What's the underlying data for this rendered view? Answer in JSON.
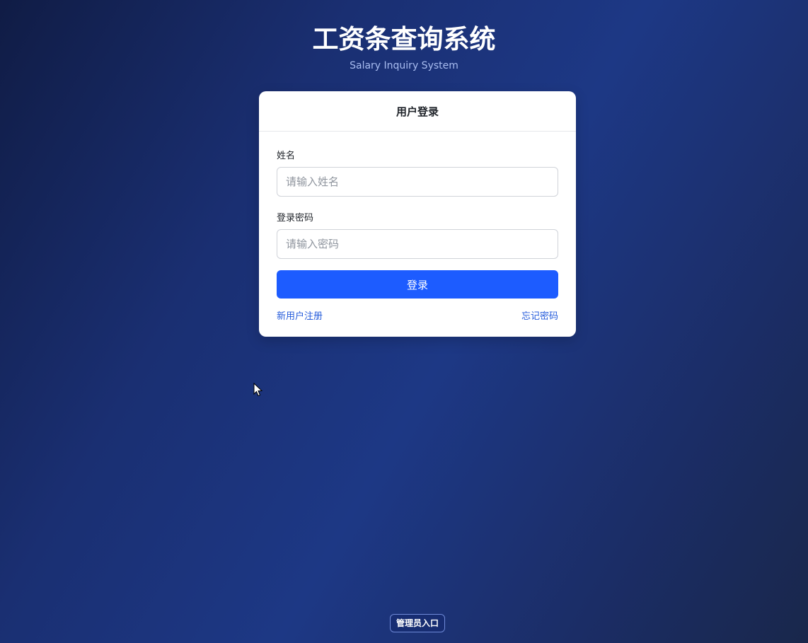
{
  "header": {
    "title": "工资条查询系统",
    "subtitle": "Salary Inquiry System"
  },
  "login_card": {
    "title": "用户登录",
    "name_field": {
      "label": "姓名",
      "value": "",
      "placeholder": "请输入姓名"
    },
    "password_field": {
      "label": "登录密码",
      "value": "",
      "placeholder": "请输入密码"
    },
    "login_button_label": "登录",
    "register_link": "新用户注册",
    "forgot_password_link": "忘记密码"
  },
  "footer": {
    "admin_entry_label": "管理员入口"
  },
  "colors": {
    "primary_button": "#1d5cff",
    "link": "#245bdb",
    "background_dark": "#101c45",
    "background_mid": "#1d3885"
  },
  "icons": {
    "cursor": "mouse-pointer-icon"
  }
}
